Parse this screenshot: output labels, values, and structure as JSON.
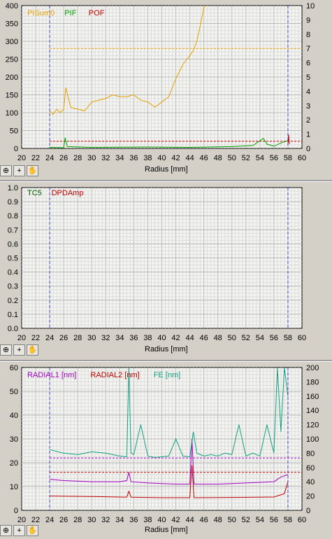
{
  "chart_data": [
    {
      "type": "line",
      "xlabel": "Radius [mm]",
      "xlim": [
        20,
        60
      ],
      "x_ticks": [
        "20",
        "22",
        "24",
        "26",
        "28",
        "30",
        "32",
        "34",
        "36",
        "38",
        "40",
        "42",
        "44",
        "46",
        "48",
        "50",
        "52",
        "54",
        "56",
        "58",
        "60"
      ],
      "ylim": [
        0,
        400
      ],
      "y_ticks": [
        "0",
        "50",
        "100",
        "150",
        "200",
        "250",
        "300",
        "350",
        "400"
      ],
      "y2lim": [
        0,
        10
      ],
      "y2_ticks": [
        "0",
        "1",
        "2",
        "3",
        "4",
        "5",
        "6",
        "7",
        "8",
        "9",
        "10"
      ],
      "legend": [
        {
          "name": "PISum0",
          "color": "#e8a000"
        },
        {
          "name": "PIF",
          "color": "#00a000"
        },
        {
          "name": "POF",
          "color": "#c00000"
        }
      ],
      "series": [
        {
          "name": "PISum0",
          "color": "#e8a000",
          "x": [
            24,
            24.5,
            25,
            25.5,
            26,
            26.3,
            27,
            28,
            29,
            30,
            31,
            32,
            33,
            34,
            35,
            36,
            37,
            38,
            39,
            40,
            41,
            42,
            43,
            44,
            44.5,
            45,
            45.5,
            46,
            46.5
          ],
          "y": [
            105,
            95,
            110,
            100,
            110,
            170,
            115,
            110,
            105,
            130,
            135,
            140,
            150,
            145,
            145,
            150,
            135,
            130,
            115,
            130,
            145,
            195,
            235,
            260,
            275,
            300,
            345,
            395,
            410
          ]
        },
        {
          "name": "PIF",
          "color": "#00a000",
          "x": [
            24,
            26,
            26.2,
            26.5,
            30,
            38,
            44,
            50,
            53,
            54.5,
            55,
            56,
            57,
            58
          ],
          "y": [
            3,
            2,
            30,
            5,
            3,
            4,
            3,
            5,
            8,
            28,
            12,
            6,
            15,
            22
          ]
        },
        {
          "name": "POF",
          "color": "#c00000",
          "x": [
            58,
            58.1,
            58.2
          ],
          "y": [
            10,
            38,
            12
          ]
        }
      ],
      "reference_lines": [
        {
          "axis": "y2",
          "value": 7,
          "color": "#e8a000"
        },
        {
          "axis": "y",
          "value": 20,
          "color": "#c00000"
        }
      ],
      "markers_x": [
        24,
        58
      ],
      "grid": true
    },
    {
      "type": "line",
      "xlabel": "Radius [mm]",
      "xlim": [
        20,
        60
      ],
      "x_ticks": [
        "20",
        "22",
        "24",
        "26",
        "28",
        "30",
        "32",
        "34",
        "36",
        "38",
        "40",
        "42",
        "44",
        "46",
        "48",
        "50",
        "52",
        "54",
        "56",
        "58",
        "60"
      ],
      "ylim": [
        0,
        1
      ],
      "y_ticks": [
        "0.0",
        "0.1",
        "0.2",
        "0.3",
        "0.4",
        "0.5",
        "0.6",
        "0.7",
        "0.8",
        "0.9",
        "1.0"
      ],
      "legend": [
        {
          "name": "TC5",
          "color": "#006000"
        },
        {
          "name": "DPDAmp",
          "color": "#c00000"
        }
      ],
      "series": [],
      "markers_x": [
        24,
        58
      ],
      "grid": true
    },
    {
      "type": "line",
      "xlabel": "Radius [mm]",
      "xlim": [
        20,
        60
      ],
      "x_ticks": [
        "20",
        "22",
        "24",
        "26",
        "28",
        "30",
        "32",
        "34",
        "36",
        "38",
        "40",
        "42",
        "44",
        "46",
        "48",
        "50",
        "52",
        "54",
        "56",
        "58",
        "60"
      ],
      "ylim": [
        0,
        60
      ],
      "y_ticks": [
        "0",
        "10",
        "20",
        "30",
        "40",
        "50",
        "60"
      ],
      "y2lim": [
        0,
        200
      ],
      "y2_ticks": [
        "0",
        "20",
        "40",
        "60",
        "80",
        "100",
        "120",
        "140",
        "160",
        "180",
        "200"
      ],
      "legend": [
        {
          "name": "RADIAL1 [nm]",
          "color": "#a000c0"
        },
        {
          "name": "RADIAL2 [nm]",
          "color": "#c00000"
        },
        {
          "name": "FE [nm]",
          "color": "#10a080"
        }
      ],
      "series": [
        {
          "name": "RADIAL1 [nm]",
          "color": "#a000c0",
          "x": [
            24,
            26,
            30,
            34,
            35,
            35.3,
            35.6,
            38,
            42,
            44,
            44.3,
            44.6,
            48,
            52,
            56,
            57,
            58
          ],
          "y": [
            13,
            12.5,
            12,
            12,
            12.5,
            16,
            12,
            11.5,
            11,
            11,
            30,
            11,
            11,
            11.5,
            12,
            14,
            15
          ]
        },
        {
          "name": "RADIAL2 [nm]",
          "color": "#c00000",
          "x": [
            24,
            30,
            35,
            35.3,
            35.6,
            40,
            44,
            44.3,
            44.6,
            50,
            56,
            57.5,
            58
          ],
          "y": [
            6,
            5.8,
            5.5,
            8,
            5.5,
            5.3,
            5.3,
            19,
            5.3,
            5.4,
            5.6,
            7,
            12
          ]
        },
        {
          "name": "FE [nm]",
          "color": "#10a080",
          "x": [
            24,
            26,
            28,
            30,
            32,
            34,
            35,
            35.3,
            35.6,
            36,
            37,
            38,
            39,
            40,
            41,
            42,
            43,
            44,
            44.5,
            45,
            46,
            47,
            48,
            49,
            50,
            51,
            52,
            53,
            54,
            55,
            56,
            56.5,
            57,
            57.5,
            58
          ],
          "y": [
            85,
            80,
            78,
            82,
            80,
            76,
            75,
            200,
            80,
            78,
            120,
            76,
            74,
            75,
            76,
            100,
            76,
            75,
            110,
            80,
            76,
            78,
            76,
            80,
            78,
            120,
            76,
            80,
            76,
            120,
            80,
            200,
            110,
            200,
            160
          ]
        }
      ],
      "reference_lines": [
        {
          "axis": "y",
          "value": 22,
          "color": "#a000c0"
        },
        {
          "axis": "y",
          "value": 16,
          "color": "#c00000"
        }
      ],
      "markers_x": [
        24,
        58
      ],
      "grid": true
    }
  ]
}
